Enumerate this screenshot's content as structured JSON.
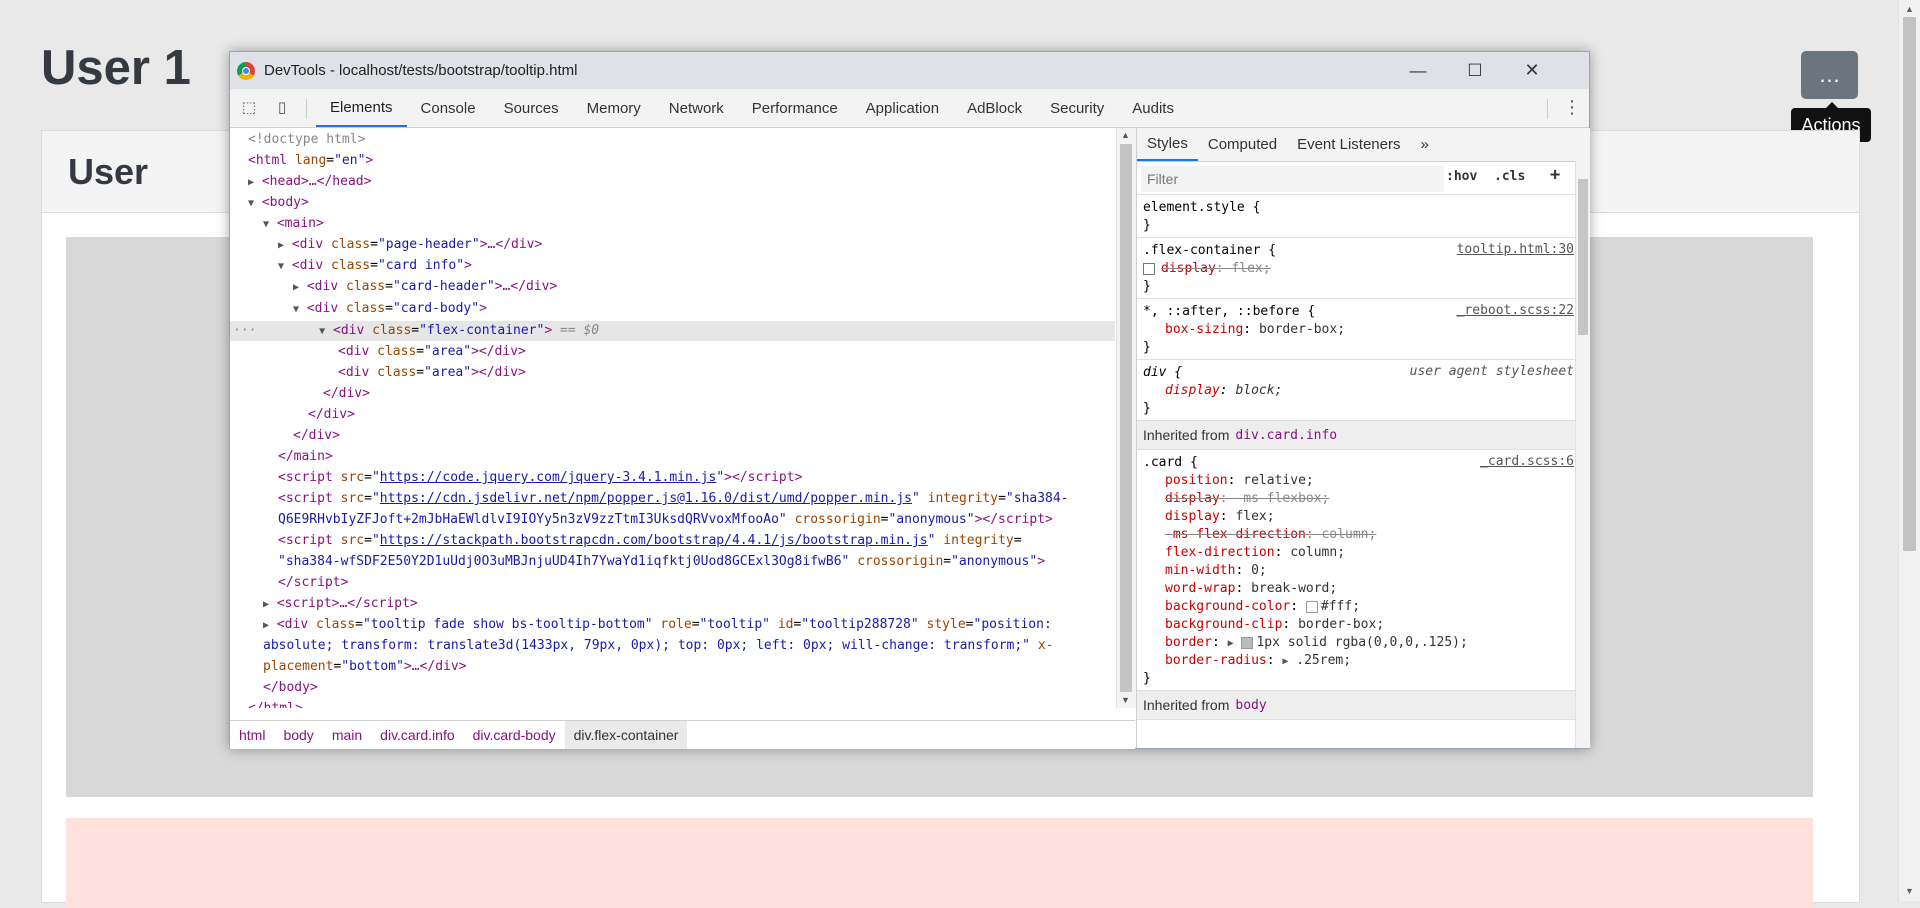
{
  "page": {
    "title": "User 1",
    "action_button_label": "…",
    "tooltip_text": "Actions",
    "card_header": "User"
  },
  "devtools": {
    "window_title": "DevTools - localhost/tests/bootstrap/tooltip.html",
    "controls": {
      "minimize": "—",
      "maximize": "☐",
      "close": "✕"
    },
    "tabs": [
      "Elements",
      "Console",
      "Sources",
      "Memory",
      "Network",
      "Performance",
      "Application",
      "AdBlock",
      "Security",
      "Audits"
    ],
    "active_tab": "Elements",
    "dom": {
      "l1": "<!doctype html>",
      "l2_tag": "<html",
      "l2_attr": "lang",
      "l2_val": "\"en\"",
      "l2_end": ">",
      "l3": "<head>…</head>",
      "l4": "<body>",
      "l5": "<main>",
      "l6_class": "\"page-header\"",
      "l7_class": "\"card info\"",
      "l8_class": "\"card-header\"",
      "l9_class": "\"card-body\"",
      "l10_class": "\"flex-container\"",
      "l10_marker": "== $0",
      "l11_class": "\"area\"",
      "l12_class": "\"area\"",
      "script1_src": "https://code.jquery.com/jquery-3.4.1.min.js",
      "script2_src": "https://cdn.jsdelivr.net/npm/popper.js@1.16.0/dist/umd/popper.min.js",
      "script2_integrity_1": "\"sha384-",
      "script2_integrity_2": "Q6E9RHvbIyZFJoft+2mJbHaEWldlvI9IOYy5n3zV9zzTtmI3UksdQRVvoxMfooAo\"",
      "script3_src": "https://stackpath.bootstrapcdn.com/bootstrap/4.4.1/js/bootstrap.min.js",
      "script3_integrity": "\"sha384-wfSDF2E50Y2D1uUdj0O3uMBJnjuUD4Ih7YwaYd1iqfktj0Uod8GCExl3Og8ifwB6\"",
      "crossorigin": "\"anonymous\"",
      "tooltip_class": "\"tooltip fade show bs-tooltip-bottom\"",
      "tooltip_role": "\"tooltip\"",
      "tooltip_id": "\"tooltip288728\"",
      "tooltip_style_1": "\"position:",
      "tooltip_style_2": "absolute; transform: translate3d(1433px, 79px, 0px); top: 0px; left: 0px; will-change: transform;\"",
      "tooltip_placement_1": "x-",
      "tooltip_placement_2": "placement",
      "tooltip_placement_val": "\"bottom\""
    },
    "breadcrumbs": [
      "html",
      "body",
      "main",
      "div.card.info",
      "div.card-body",
      "div.flex-container"
    ],
    "styles": {
      "tabs": [
        "Styles",
        "Computed",
        "Event Listeners"
      ],
      "more": "»",
      "filter_placeholder": "Filter",
      "hov": ":hov",
      "cls": ".cls",
      "plus": "+",
      "element_style": "element.style {",
      "flex_selector": ".flex-container {",
      "flex_source": "tooltip.html:30",
      "flex_prop": "display",
      "flex_val": "flex;",
      "universal_selector": "*, ::after, ::before {",
      "universal_source": "_reboot.scss:22",
      "box_sizing_prop": "box-sizing",
      "box_sizing_val": "border-box;",
      "div_selector": "div {",
      "div_source": "user agent stylesheet",
      "div_prop": "display",
      "div_val": "block;",
      "inherited_label": "Inherited from",
      "inherited_card": "div.card.info",
      "card_selector": ".card {",
      "card_source": "_card.scss:6",
      "card_props": [
        {
          "prop": "position",
          "val": "relative;",
          "struck": false
        },
        {
          "prop": "display",
          "val": "-ms-flexbox;",
          "struck": true
        },
        {
          "prop": "display",
          "val": "flex;",
          "struck": false
        },
        {
          "prop": "-ms-flex-direction",
          "val": "column;",
          "struck": true
        },
        {
          "prop": "flex-direction",
          "val": "column;",
          "struck": false
        },
        {
          "prop": "min-width",
          "val": "0;",
          "struck": false
        },
        {
          "prop": "word-wrap",
          "val": "break-word;",
          "struck": false
        },
        {
          "prop": "background-color",
          "val": "#fff;",
          "struck": false
        },
        {
          "prop": "background-clip",
          "val": "border-box;",
          "struck": false
        },
        {
          "prop": "border",
          "val": "1px solid rgba(0,0,0,.125);",
          "struck": false
        },
        {
          "prop": "border-radius",
          "val": ".25rem;",
          "struck": false
        }
      ],
      "inherited_body": "body",
      "close_brace": "}"
    }
  }
}
